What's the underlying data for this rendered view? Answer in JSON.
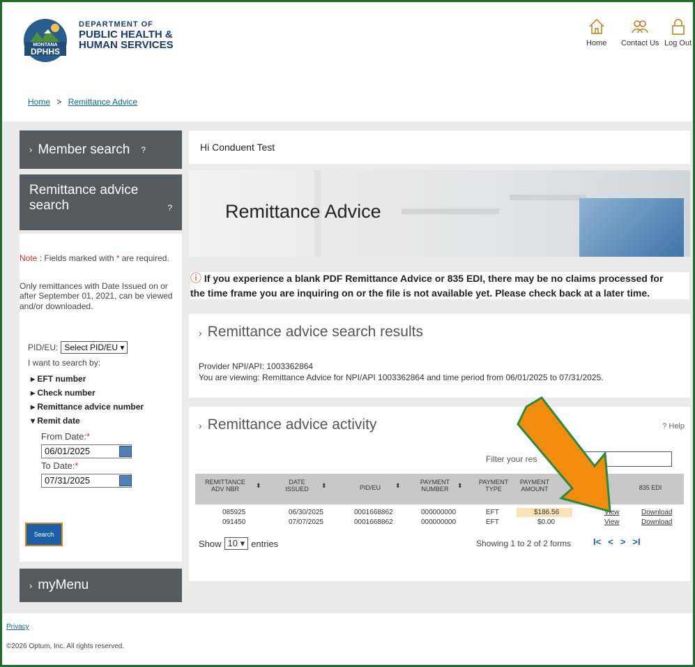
{
  "header": {
    "logo_badge_top": "MONTANA",
    "logo_badge_bottom": "DPHHS",
    "logo_line1": "DEPARTMENT OF",
    "logo_line2": "PUBLIC HEALTH &",
    "logo_line3": "HUMAN SERVICES",
    "nav": {
      "home": "Home",
      "contact": "Contact Us",
      "logout": "Log Out"
    }
  },
  "breadcrumb": {
    "home": "Home",
    "sep": ">",
    "current": "Remittance Advice"
  },
  "sidebar": {
    "member_search": "Member search",
    "member_search_help": "?",
    "remit_search_line1": "Remittance advice",
    "remit_search_line2": "search",
    "remit_search_help": "?",
    "note_label": "Note",
    "note_text": " : Fields marked with ",
    "note_text2": " are required.",
    "only_text": "Only remittances with Date Issued on or after September 01, 2021, can be viewed and/or downloaded.",
    "pid_label": "PID/EU:",
    "pid_select": "Select PID/EU",
    "search_by": "I want to search by:",
    "options": [
      "EFT number",
      "Check number",
      "Remittance advice number",
      "Remit date"
    ],
    "from_label": "From Date:",
    "from_value": "06/01/2025",
    "to_label": "To Date:",
    "to_value": "07/31/2025",
    "search_button": "Search",
    "mymenu": "myMenu"
  },
  "main": {
    "greeting": "Hi Conduent Test",
    "hero_title": "Remittance Advice",
    "warning_line1": "If you experience a blank PDF Remittance Advice or 835 EDI, there may be no claims processed for",
    "warning_line2": "the time frame you are inquiring on or the file is not available yet. Please check back at a later time.",
    "results_title": "Remittance advice search results",
    "provider_line": "Provider NPI/API: 1003362864",
    "viewing_line": "You are viewing: Remittance Advice for NPI/API 1003362864 and time period from 06/01/2025 to 07/31/2025.",
    "activity_title": "Remittance advice activity",
    "help": "Help",
    "filter_label": "Filter your res"
  },
  "table": {
    "headers": [
      "REMITTANCE ADV NBR",
      "DATE ISSUED",
      "PID/EU",
      "PAYMENT NUMBER",
      "PAYMENT TYPE",
      "PAYMENT AMOUNT",
      "",
      "835 EDI"
    ],
    "rows": [
      [
        "085925",
        "06/30/2025",
        "0001668862",
        "000000000",
        "EFT",
        "$186.56",
        "View",
        "Download"
      ],
      [
        "091450",
        "07/07/2025",
        "0001668862",
        "000000000",
        "EFT",
        "$0.00",
        "View",
        "Download"
      ]
    ],
    "show_label": "Show",
    "show_value": "10",
    "entries_label": "entries",
    "showing": "Showing 1 to 2 of 2 forms",
    "pager": [
      "I<",
      "<",
      ">",
      ">I"
    ]
  },
  "footer": {
    "privacy": "Privacy",
    "copyright": "©2026 Optum, Inc. All rights reserved."
  },
  "colors": {
    "frame": "#1e6b2a",
    "sidebar_dark": "#555a5e",
    "link": "#0b6a8a",
    "highlight": "#fbe3b8",
    "arrow": "#f28c0f"
  }
}
